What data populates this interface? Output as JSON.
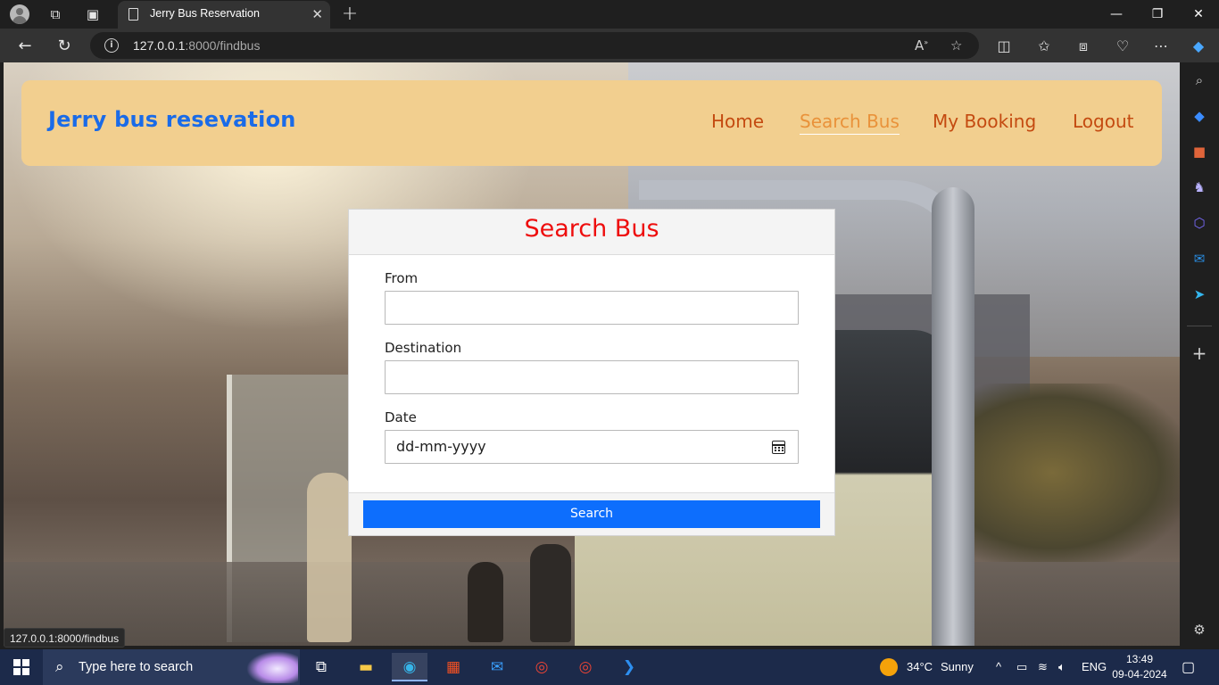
{
  "browser": {
    "tab_title": "Jerry Bus Reservation",
    "url_host": "127.0.0.1",
    "url_path": ":8000/findbus",
    "status_url": "127.0.0.1:8000/findbus"
  },
  "site": {
    "brand": "Jerry bus resevation",
    "nav": [
      "Home",
      "Search Bus",
      "My Booking",
      "Logout"
    ],
    "active_nav": "Search Bus"
  },
  "form": {
    "title": "Search Bus",
    "from_label": "From",
    "from_value": "",
    "destination_label": "Destination",
    "destination_value": "",
    "date_label": "Date",
    "date_placeholder": "dd-mm-yyyy",
    "submit_label": "Search"
  },
  "taskbar": {
    "search_placeholder": "Type here to search",
    "weather_temp": "34°C",
    "weather_text": "Sunny",
    "language": "ENG",
    "time": "13:49",
    "date": "09-04-2024"
  },
  "colors": {
    "brand": "#1a6be8",
    "navbar_bg": "#f2cf8f",
    "nav_link": "#c44a10",
    "nav_active": "#e9923a",
    "form_title": "#ee0d0d",
    "button": "#0d6efd"
  }
}
